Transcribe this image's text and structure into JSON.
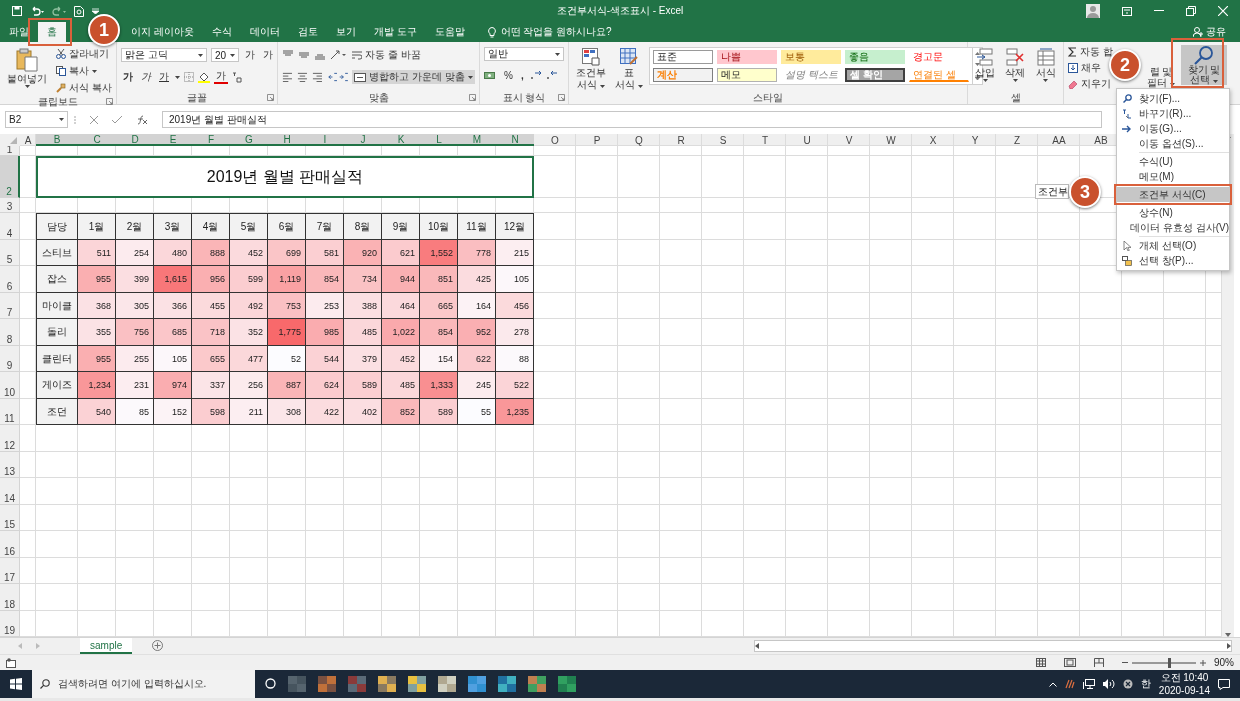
{
  "window": {
    "title": "조건부서식-색조표시 - Excel",
    "share": "공유"
  },
  "tabs": [
    {
      "label": "파일",
      "selected": false
    },
    {
      "label": "홈",
      "selected": true
    },
    {
      "label": "이지 레이아웃",
      "selected": false
    },
    {
      "label": "수식",
      "selected": false
    },
    {
      "label": "데이터",
      "selected": false
    },
    {
      "label": "검토",
      "selected": false
    },
    {
      "label": "보기",
      "selected": false
    },
    {
      "label": "개발 도구",
      "selected": false
    },
    {
      "label": "도움말",
      "selected": false
    }
  ],
  "tell_me": "어떤 작업을 원하시나요?",
  "clipboard": {
    "label": "클립보드",
    "paste": "붙여넣기",
    "cut": "잘라내기",
    "copy": "복사",
    "format_painter": "서식 복사"
  },
  "font": {
    "label": "글꼴",
    "name": "맑은 고딕",
    "size": "20",
    "size_buttons": [
      "가",
      "가"
    ],
    "style_buttons": [
      "가",
      "가",
      "가"
    ],
    "font_color": "가"
  },
  "alignment": {
    "label": "맞춤",
    "wrap": "자동 줄 바꿈",
    "merge": "병합하고 가운데 맞춤"
  },
  "number": {
    "label": "표시 형식",
    "format": "일반",
    "percent": "%",
    "comma": ","
  },
  "styles": {
    "label": "스타일",
    "conditional": [
      "조건부",
      "서식"
    ],
    "table_format": [
      "표",
      "서식"
    ],
    "cells": [
      {
        "label": "표준",
        "kind": "normal"
      },
      {
        "label": "나쁨",
        "kind": "bad"
      },
      {
        "label": "보통",
        "kind": "neutral"
      },
      {
        "label": "좋음",
        "kind": "good"
      },
      {
        "label": "경고문",
        "kind": "warning"
      },
      {
        "label": "계산",
        "kind": "calculation"
      },
      {
        "label": "메모",
        "kind": "note"
      },
      {
        "label": "설명 텍스트",
        "kind": "explanatory"
      },
      {
        "label": "셀 확인",
        "kind": "check"
      },
      {
        "label": "연결된 셀",
        "kind": "linked"
      }
    ]
  },
  "cells_group": {
    "label": "셀",
    "buttons": [
      "삽입",
      "삭제",
      "서식"
    ]
  },
  "editing": {
    "autosum": "자동 합",
    "fill": "채우",
    "clear": "지우기",
    "sort": [
      "렬 및",
      "필터"
    ],
    "find": [
      "찾기 및",
      "선택"
    ],
    "find_pressed": true
  },
  "formula_bar": {
    "name_box": "B2",
    "formula": "2019년 월별 판매실적"
  },
  "sheet": {
    "column_headers": [
      "A",
      "B",
      "C",
      "D",
      "E",
      "F",
      "G",
      "H",
      "I",
      "J",
      "K",
      "L",
      "M",
      "N",
      "O",
      "P",
      "Q",
      "R",
      "S",
      "T",
      "U",
      "V",
      "W",
      "X",
      "Y",
      "Z",
      "AA",
      "AB"
    ],
    "row_headers": [
      "1",
      "2",
      "3",
      "4",
      "5",
      "6",
      "7",
      "8",
      "9",
      "10",
      "11",
      "12",
      "13",
      "14",
      "15",
      "16",
      "17",
      "18",
      "19"
    ],
    "title": "2019년 월별 판매실적",
    "title_selected": true,
    "table": {
      "columns": [
        "담당",
        "1월",
        "2월",
        "3월",
        "4월",
        "5월",
        "6월",
        "7월",
        "8월",
        "9월",
        "10월",
        "11월",
        "12월"
      ],
      "rows": [
        {
          "name": "스티브",
          "values": [
            "511",
            "254",
            "480",
            "888",
            "452",
            "699",
            "581",
            "920",
            "621",
            "1,552",
            "778",
            "215"
          ]
        },
        {
          "name": "잡스",
          "values": [
            "955",
            "399",
            "1,615",
            "956",
            "599",
            "1,119",
            "854",
            "734",
            "944",
            "851",
            "425",
            "105"
          ]
        },
        {
          "name": "마이클",
          "values": [
            "368",
            "305",
            "366",
            "455",
            "492",
            "753",
            "253",
            "388",
            "464",
            "665",
            "164",
            "456"
          ]
        },
        {
          "name": "돌리",
          "values": [
            "355",
            "756",
            "685",
            "718",
            "352",
            "1,775",
            "985",
            "485",
            "1,022",
            "854",
            "952",
            "278"
          ]
        },
        {
          "name": "클린터",
          "values": [
            "955",
            "255",
            "105",
            "655",
            "477",
            "52",
            "544",
            "379",
            "452",
            "154",
            "622",
            "88"
          ]
        },
        {
          "name": "게이즈",
          "values": [
            "1,234",
            "231",
            "974",
            "337",
            "256",
            "887",
            "624",
            "589",
            "485",
            "1,333",
            "245",
            "522"
          ]
        },
        {
          "name": "조던",
          "values": [
            "540",
            "85",
            "152",
            "598",
            "211",
            "308",
            "422",
            "402",
            "852",
            "589",
            "55",
            "1,235"
          ]
        }
      ]
    }
  },
  "tooltip": "조건부",
  "menu": {
    "sections": [
      [
        {
          "label": "찾기(F)...",
          "selected": false
        },
        {
          "label": "바꾸기(R)...",
          "selected": false
        },
        {
          "label": "이동(G)...",
          "selected": false
        },
        {
          "label": "이동 옵션(S)...",
          "selected": false
        }
      ],
      [
        {
          "label": "수식(U)",
          "selected": false
        },
        {
          "label": "메모(M)",
          "selected": false
        },
        {
          "label": "조건부 서식(C)",
          "selected": true
        },
        {
          "label": "상수(N)",
          "selected": false
        },
        {
          "label": "데이터 유효성 검사(V)",
          "selected": false
        }
      ],
      [
        {
          "label": "개체 선택(O)",
          "selected": false
        },
        {
          "label": "선택 창(P)...",
          "selected": false
        }
      ]
    ]
  },
  "callouts": [
    {
      "number": "1"
    },
    {
      "number": "2"
    },
    {
      "number": "3"
    }
  ],
  "sheet_tabs": [
    {
      "label": "sample",
      "selected": true
    }
  ],
  "status_bar": {
    "zoom": "90%",
    "level": 0.57
  },
  "taskbar": {
    "search_placeholder": "검색하려면 여기에 입력하십시오.",
    "ime": "한",
    "time": "오전 10:40",
    "date": "2020-09-14"
  }
}
